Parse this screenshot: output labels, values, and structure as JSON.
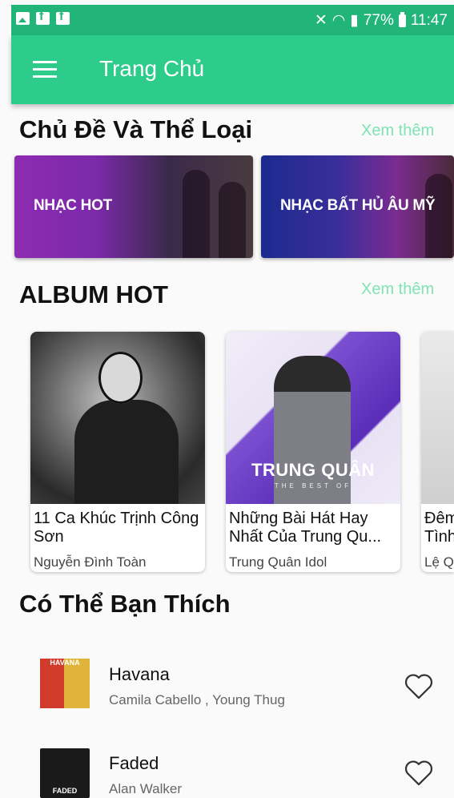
{
  "status_bar": {
    "battery": "77%",
    "time": "11:47"
  },
  "app_bar": {
    "title": "Trang Chủ"
  },
  "genres": {
    "title": "Chủ Đề Và Thể Loại",
    "see_more": "Xem thêm",
    "items": [
      {
        "label": "NHẠC HOT"
      },
      {
        "label": "NHẠC BẤT HỦ ÂU MỸ"
      }
    ]
  },
  "albums": {
    "title": "ALBUM HOT",
    "see_more": "Xem thêm",
    "items": [
      {
        "title": "11 Ca Khúc Trịnh Công Sơn",
        "artist": "Nguyễn Đình Toàn"
      },
      {
        "title": "Những Bài Hát Hay Nhất Của Trung Qu...",
        "artist": "Trung Quân Idol",
        "cover_text": "TRUNG QUÂN",
        "cover_sub": "THE BEST OF"
      },
      {
        "title": "Đêm Tình",
        "artist": "Lệ Q"
      }
    ]
  },
  "suggestions": {
    "title": "Có Thể Bạn Thích",
    "items": [
      {
        "name": "Havana",
        "artist": "Camila Cabello , Young Thug",
        "thumb_text": "HAVANA"
      },
      {
        "name": "Faded",
        "artist": "Alan Walker",
        "thumb_text": "FADED"
      }
    ]
  },
  "colors": {
    "primary": "#2ecc8a",
    "status_bar": "#21b57a",
    "accent_link": "#7fe3b6"
  },
  "icons": [
    "image-icon",
    "facebook-icon",
    "mute-icon",
    "wifi-icon",
    "signal-icon",
    "battery-icon",
    "menu-icon",
    "heart-outline-icon"
  ]
}
